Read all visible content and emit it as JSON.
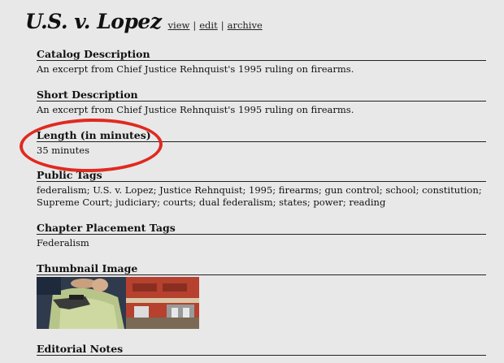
{
  "title": "U.S. v. Lopez",
  "links": {
    "view": "view",
    "edit": "edit",
    "archive": "archive",
    "separator": "|"
  },
  "sections": [
    {
      "heading": "Catalog Description",
      "body": "An excerpt from Chief Justice Rehnquist's 1995 ruling on firearms."
    },
    {
      "heading": "Short Description",
      "body": "An excerpt from Chief Justice Rehnquist's 1995 ruling on firearms."
    },
    {
      "heading": "Length (in minutes)",
      "body": "35 minutes"
    },
    {
      "heading": "Public Tags",
      "body": "federalism; U.S. v. Lopez; Justice Rehnquist; 1995; firearms; gun control; school; constitution; Supreme Court; judiciary; courts; dual federalism; states; power; reading"
    },
    {
      "heading": "Chapter Placement Tags",
      "body": "Federalism"
    },
    {
      "heading": "Thumbnail Image",
      "body": ""
    },
    {
      "heading": "Editorial Notes",
      "body": ""
    }
  ],
  "annotation_color": "#e02a20"
}
